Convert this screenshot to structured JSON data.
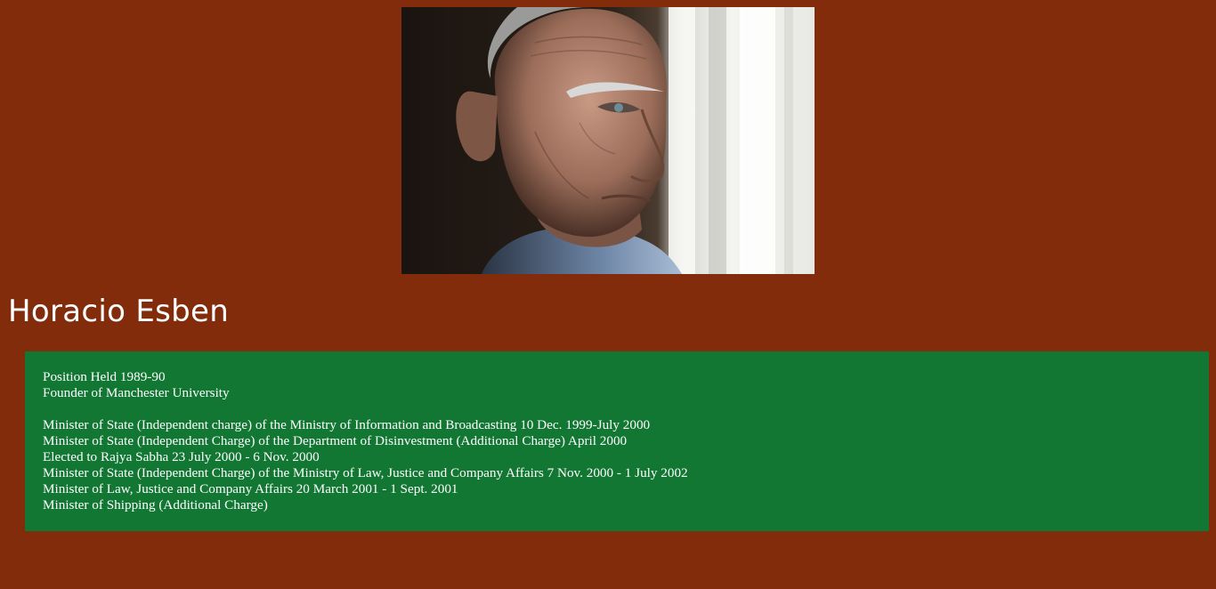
{
  "profile": {
    "name": "Horacio Esben"
  },
  "details": {
    "position_held": "Position Held 1989-90",
    "founder": "Founder of Manchester University",
    "roles": [
      "Minister of State (Independent charge) of the Ministry of Information and Broadcasting 10 Dec. 1999-July 2000",
      "Minister of State (Independent Charge) of the Department of Disinvestment (Additional Charge) April 2000",
      "Elected to Rajya Sabha 23 July 2000 - 6 Nov. 2000",
      "Minister of State (Independent Charge) of the Ministry of Law, Justice and Company Affairs 7 Nov. 2000 - 1 July 2002",
      "Minister of Law, Justice and Company Affairs 20 March 2001 - 1 Sept. 2001",
      "Minister of Shipping (Additional Charge)"
    ]
  },
  "colors": {
    "page_background": "#822C0C",
    "panel_background": "#127733",
    "text": "#ffffff"
  }
}
